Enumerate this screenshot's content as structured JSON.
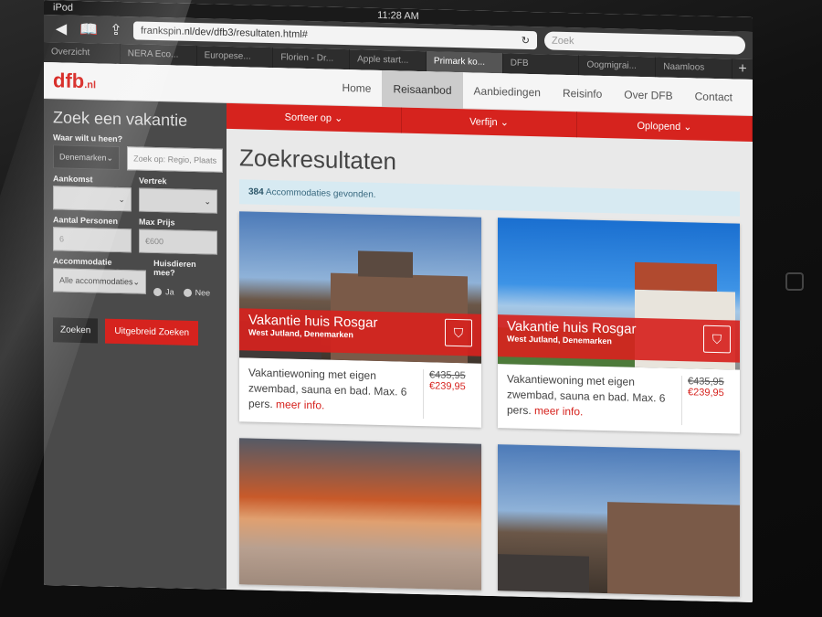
{
  "status": {
    "device": "iPod",
    "time": "11:28 AM"
  },
  "browser": {
    "url": "frankspin.nl/dev/dfb3/resultaten.html#",
    "search_placeholder": "Zoek",
    "tabs": [
      "Overzicht",
      "NERA Eco...",
      "Europese...",
      "Florien - Dr...",
      "Apple start...",
      "Primark ko...",
      "DFB",
      "Oogmigrai...",
      "Naamloos"
    ]
  },
  "site": {
    "logo": "dfb",
    "logo_suffix": ".nl",
    "nav": [
      "Home",
      "Reisaanbod",
      "Aanbiedingen",
      "Reisinfo",
      "Over DFB",
      "Contact"
    ]
  },
  "sidebar": {
    "title": "Zoek een vakantie",
    "where_label": "Waar wilt u heen?",
    "country_value": "Denemarken",
    "region_placeholder": "Zoek op: Regio, Plaats",
    "arrival_label": "Aankomst",
    "departure_label": "Vertrek",
    "persons_label": "Aantal Personen",
    "persons_value": "6",
    "maxprice_label": "Max Prijs",
    "maxprice_value": "€600",
    "accommodation_label": "Accommodatie",
    "accommodation_value": "Alle accommodaties",
    "pets_label": "Huisdieren mee?",
    "pets_yes": "Ja",
    "pets_no": "Nee",
    "search_button": "Zoeken",
    "advanced_button": "Uitgebreid Zoeken"
  },
  "filters": [
    "Sorteer op",
    "Verfijn",
    "Oplopend"
  ],
  "results": {
    "heading": "Zoekresultaten",
    "count": "384",
    "count_text": "Accommodaties gevonden."
  },
  "cards": [
    {
      "title": "Vakantie huis Rosgar",
      "location": "West Jutland, Denemarken",
      "description": "Vakantiewoning met eigen zwembad, sauna en bad. Max. 6 pers.",
      "more": "meer info.",
      "old_price": "€435,95",
      "new_price": "€239,95"
    },
    {
      "title": "Vakantie huis Rosgar",
      "location": "West Jutland, Denemarken",
      "description": "Vakantiewoning met eigen zwembad, sauna en bad. Max. 6 pers.",
      "more": "meer info.",
      "old_price": "€435,95",
      "new_price": "€239,95"
    }
  ],
  "colors": {
    "brand_red": "#d6231e",
    "sidebar": "#4a4a4a",
    "alert_bg": "#d7eaf2"
  }
}
